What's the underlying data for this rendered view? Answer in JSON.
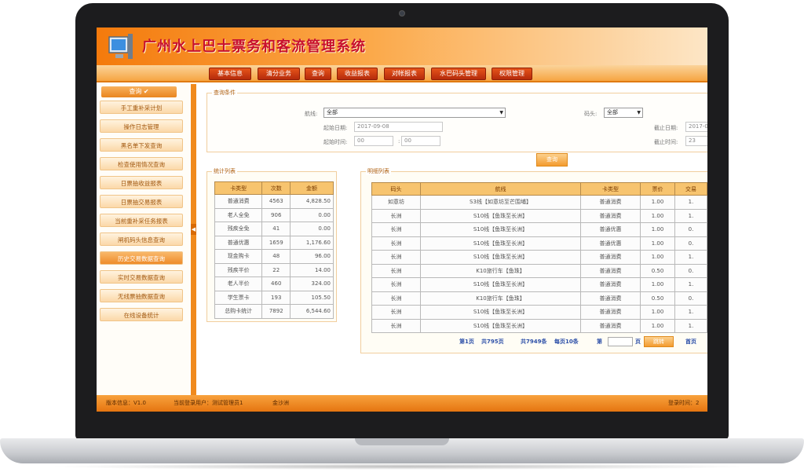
{
  "app": {
    "title": "广州水上巴士票务和客流管理系统"
  },
  "nav": [
    {
      "label": "基本信息"
    },
    {
      "label": "清分业务"
    },
    {
      "label": "查询"
    },
    {
      "label": "收益报表"
    },
    {
      "label": "对帐报表"
    },
    {
      "label": "水巴码头管理"
    },
    {
      "label": "权限管理"
    }
  ],
  "sidebar": {
    "header": "查询",
    "items": [
      {
        "label": "手工重补采计划"
      },
      {
        "label": "操作日志管理"
      },
      {
        "label": "黑名单下发查询"
      },
      {
        "label": "检查使用情况查询"
      },
      {
        "label": "日票抽收益报表"
      },
      {
        "label": "日票抽交易报表"
      },
      {
        "label": "当前重补采任务报表"
      },
      {
        "label": "闸机码头信息查询"
      },
      {
        "label": "历史交易数据查询"
      },
      {
        "label": "实时交易数据查询"
      },
      {
        "label": "无线票抽数据查询"
      },
      {
        "label": "在线设备统计"
      }
    ]
  },
  "query": {
    "legend": "查询条件",
    "route_label": "航线:",
    "route_value": "全部",
    "pier_label": "码头:",
    "pier_value": "全部",
    "start_date_label": "起始日期:",
    "start_date_value": "2017-09-08",
    "start_time_label": "起始时间:",
    "start_hour": "00",
    "start_minute": "00",
    "time_sep": ":",
    "end_date_label": "截止日期:",
    "end_date_value": "2017-0",
    "end_time_label": "截止时间:",
    "end_hour": "23",
    "button": "查询"
  },
  "stats": {
    "legend": "统计列表",
    "headers": [
      "卡类型",
      "次数",
      "金额"
    ],
    "rows": [
      [
        "普通消费",
        "4563",
        "4,828.50"
      ],
      [
        "老人全免",
        "906",
        "0.00"
      ],
      [
        "残疾全免",
        "41",
        "0.00"
      ],
      [
        "普通优惠",
        "1659",
        "1,176.60"
      ],
      [
        "现金购卡",
        "48",
        "96.00"
      ],
      [
        "残疾半价",
        "22",
        "14.00"
      ],
      [
        "老人半价",
        "460",
        "324.00"
      ],
      [
        "学生票卡",
        "193",
        "105.50"
      ],
      [
        "总购卡统计",
        "7892",
        "6,544.60"
      ]
    ]
  },
  "detail": {
    "legend": "明细列表",
    "headers": [
      "码头",
      "航线",
      "卡类型",
      "票价",
      "交易"
    ],
    "rows": [
      [
        "如意坊",
        "S3线【如意坊至芒围埔】",
        "普通消费",
        "1.00",
        "1."
      ],
      [
        "长洲",
        "S10线【鱼珠至长洲】",
        "普通消费",
        "1.00",
        "1."
      ],
      [
        "长洲",
        "S10线【鱼珠至长洲】",
        "普通优惠",
        "1.00",
        "0."
      ],
      [
        "长洲",
        "S10线【鱼珠至长洲】",
        "普通优惠",
        "1.00",
        "0."
      ],
      [
        "长洲",
        "S10线【鱼珠至长洲】",
        "普通消费",
        "1.00",
        "1."
      ],
      [
        "长洲",
        "K10旅行车【鱼珠】",
        "普通消费",
        "0.50",
        "0."
      ],
      [
        "长洲",
        "S10线【鱼珠至长洲】",
        "普通消费",
        "1.00",
        "1."
      ],
      [
        "长洲",
        "K10旅行车【鱼珠】",
        "普通消费",
        "0.50",
        "0."
      ],
      [
        "长洲",
        "S10线【鱼珠至长洲】",
        "普通消费",
        "1.00",
        "1."
      ],
      [
        "长洲",
        "S10线【鱼珠至长洲】",
        "普通消费",
        "1.00",
        "1."
      ]
    ],
    "pager": {
      "current": "第1页",
      "total_pages": "共795页",
      "total_records": "共7949条",
      "per_page": "每页10条",
      "goto_label": "第",
      "page_unit": "页",
      "go_button": "跳转",
      "first_page": "首页"
    }
  },
  "status": {
    "version": "版本信息：V1.0",
    "user": "当前登录用户：测试管理员1",
    "location": "金沙洲",
    "login_time": "登录时间：2"
  }
}
